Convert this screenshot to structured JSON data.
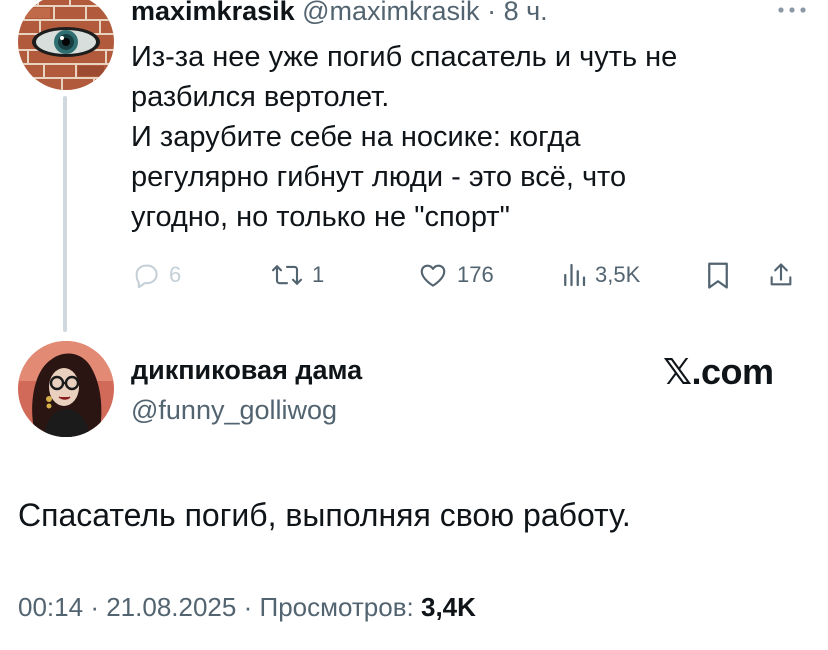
{
  "parent_tweet": {
    "author_name": "maximkrasik",
    "author_handle": "@maximkrasik",
    "separator": "·",
    "time_ago": "8 ч.",
    "text_lines": [
      "Из-за нее уже погиб спасатель и чуть не",
      "разбился вертолет.",
      "И зарубите себе на носике: когда",
      "регулярно гибнут люди - это всё, что",
      "угодно, но только не \"спорт\""
    ],
    "actions": {
      "replies": "6",
      "retweets": "1",
      "likes": "176",
      "views": "3,5K"
    },
    "icons": {
      "more": "more-dots-icon",
      "reply": "reply-bubble-icon",
      "retweet": "retweet-icon",
      "like": "heart-icon",
      "views": "views-bars-icon",
      "bookmark": "bookmark-icon",
      "share": "share-icon"
    }
  },
  "main_tweet": {
    "author_name": "дикпиковая дама",
    "author_handle": "@funny_golliwog",
    "brand": "𝕏.com",
    "text": "Спасатель погиб, выполняя свою работу.",
    "time": "00:14",
    "date": "21.08.2025",
    "separator": "·",
    "views_label": "Просмотров:",
    "views_count": "3,4K"
  },
  "colors": {
    "text_primary": "#0f1419",
    "text_secondary": "#536471",
    "thread_line": "#cfd9de"
  }
}
